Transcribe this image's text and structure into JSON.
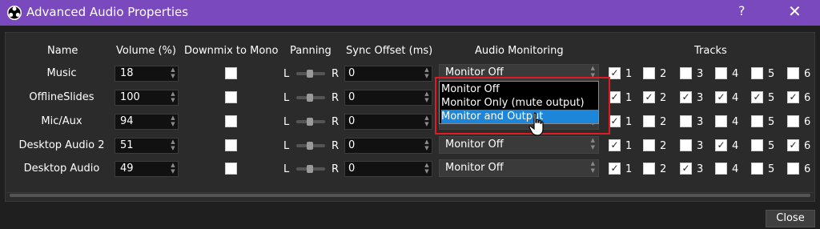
{
  "window": {
    "title": "Advanced Audio Properties",
    "help": "?",
    "close": "✕"
  },
  "headers": {
    "name": "Name",
    "volume": "Volume (%)",
    "downmix": "Downmix to Mono",
    "panning": "Panning",
    "sync": "Sync Offset (ms)",
    "monitoring": "Audio Monitoring",
    "tracks": "Tracks"
  },
  "pan": {
    "left": "L",
    "right": "R"
  },
  "track_labels": [
    "1",
    "2",
    "3",
    "4",
    "5",
    "6"
  ],
  "rows": [
    {
      "name": "Music",
      "volume": "18",
      "sync": "0",
      "monitor": "Monitor Off",
      "tracks": [
        true,
        false,
        false,
        false,
        false,
        false
      ]
    },
    {
      "name": "OfflineSlides",
      "volume": "100",
      "sync": "0",
      "monitor": "",
      "tracks": [
        true,
        true,
        true,
        true,
        true,
        true
      ]
    },
    {
      "name": "Mic/Aux",
      "volume": "94",
      "sync": "0",
      "monitor": "Monitor Off",
      "tracks": [
        true,
        false,
        false,
        false,
        false,
        false
      ]
    },
    {
      "name": "Desktop Audio 2",
      "volume": "51",
      "sync": "0",
      "monitor": "Monitor Off",
      "tracks": [
        true,
        false,
        false,
        true,
        false,
        true
      ]
    },
    {
      "name": "Desktop Audio",
      "volume": "49",
      "sync": "0",
      "monitor": "Monitor Off",
      "tracks": [
        true,
        false,
        true,
        false,
        false,
        false
      ]
    }
  ],
  "dropdown": {
    "options": [
      "Monitor Off",
      "Monitor Only (mute output)",
      "Monitor and Output"
    ],
    "highlighted": "Monitor and Output"
  },
  "footer": {
    "close": "Close"
  },
  "colors": {
    "titlebar": "#7a49bd",
    "highlight": "#1e86d8",
    "callout": "#e01b24"
  },
  "icons": {
    "app": "obs-logo-icon",
    "cursor": "hand-pointer-cursor-icon"
  }
}
